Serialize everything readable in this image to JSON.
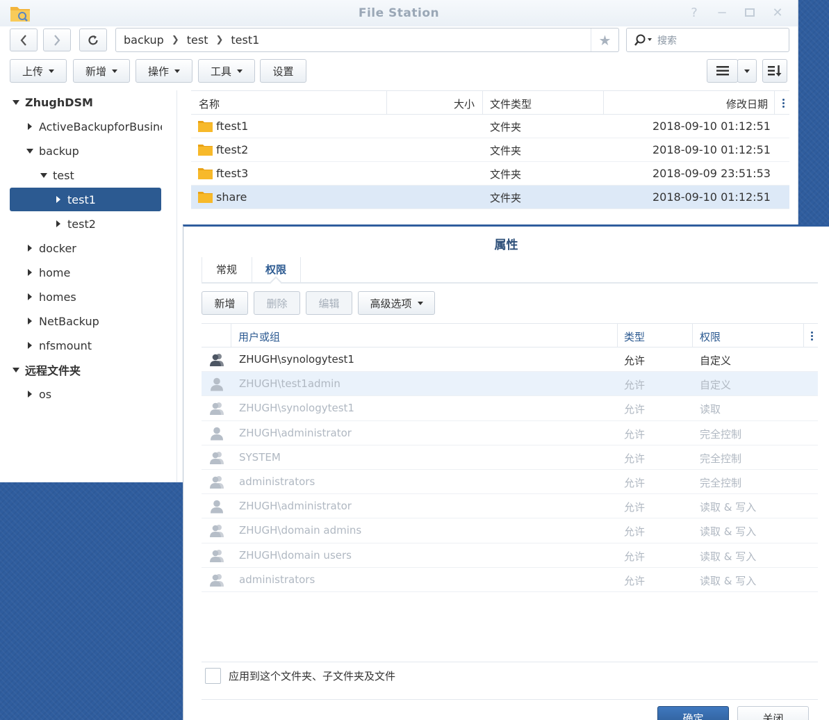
{
  "window": {
    "title": "File Station",
    "controls": [
      "help-icon",
      "minimize-icon",
      "maximize-icon",
      "close-icon"
    ]
  },
  "path": {
    "segments": [
      "backup",
      "test",
      "test1"
    ]
  },
  "search": {
    "placeholder": "搜索"
  },
  "toolbar": {
    "upload": "上传",
    "create": "新增",
    "action": "操作",
    "tools": "工具",
    "settings": "设置"
  },
  "tree": {
    "root": "ZhughDSM",
    "items": [
      "ActiveBackupforBusiness",
      "backup",
      "test",
      "test1",
      "test2",
      "docker",
      "home",
      "homes",
      "NetBackup",
      "nfsmount"
    ],
    "remote_root": "远程文件夹",
    "remote_items": [
      "os"
    ]
  },
  "file_list": {
    "headers": {
      "name": "名称",
      "size": "大小",
      "type": "文件类型",
      "modified": "修改日期"
    },
    "rows": [
      {
        "name": "ftest1",
        "type": "文件夹",
        "modified": "2018-09-10 01:12:51"
      },
      {
        "name": "ftest2",
        "type": "文件夹",
        "modified": "2018-09-10 01:12:51"
      },
      {
        "name": "ftest3",
        "type": "文件夹",
        "modified": "2018-09-09 23:51:53"
      },
      {
        "name": "share",
        "type": "文件夹",
        "modified": "2018-09-10 01:12:51"
      }
    ]
  },
  "properties": {
    "title": "属性",
    "tabs": [
      "常规",
      "权限"
    ],
    "buttons": {
      "add": "新增",
      "delete": "删除",
      "edit": "编辑",
      "advanced": "高级选项"
    },
    "headers": {
      "user": "用户或组",
      "type": "类型",
      "permission": "权限"
    },
    "rows": [
      {
        "icon": "group-icon",
        "user": "ZHUGH\\synologytest1",
        "type": "允许",
        "permission": "自定义"
      },
      {
        "icon": "user-icon",
        "user": "ZHUGH\\test1admin",
        "type": "允许",
        "permission": "自定义"
      },
      {
        "icon": "group-icon",
        "user": "ZHUGH\\synologytest1",
        "type": "允许",
        "permission": "读取"
      },
      {
        "icon": "user-icon",
        "user": "ZHUGH\\administrator",
        "type": "允许",
        "permission": "完全控制"
      },
      {
        "icon": "group-icon",
        "user": "SYSTEM",
        "type": "允许",
        "permission": "完全控制"
      },
      {
        "icon": "group-icon",
        "user": "administrators",
        "type": "允许",
        "permission": "完全控制"
      },
      {
        "icon": "user-icon",
        "user": "ZHUGH\\administrator",
        "type": "允许",
        "permission": "读取 & 写入"
      },
      {
        "icon": "group-icon",
        "user": "ZHUGH\\domain admins",
        "type": "允许",
        "permission": "读取 & 写入"
      },
      {
        "icon": "group-icon",
        "user": "ZHUGH\\domain users",
        "type": "允许",
        "permission": "读取 & 写入"
      },
      {
        "icon": "group-icon",
        "user": "administrators",
        "type": "允许",
        "permission": "读取 & 写入"
      }
    ],
    "apply_label": "应用到这个文件夹、子文件夹及文件",
    "ok": "确定",
    "close": "关闭"
  },
  "colors": {
    "accent": "#2c5a91",
    "selection": "#dde9f7",
    "desktop": "#2f5d9e",
    "folder": "#f5b21b"
  }
}
